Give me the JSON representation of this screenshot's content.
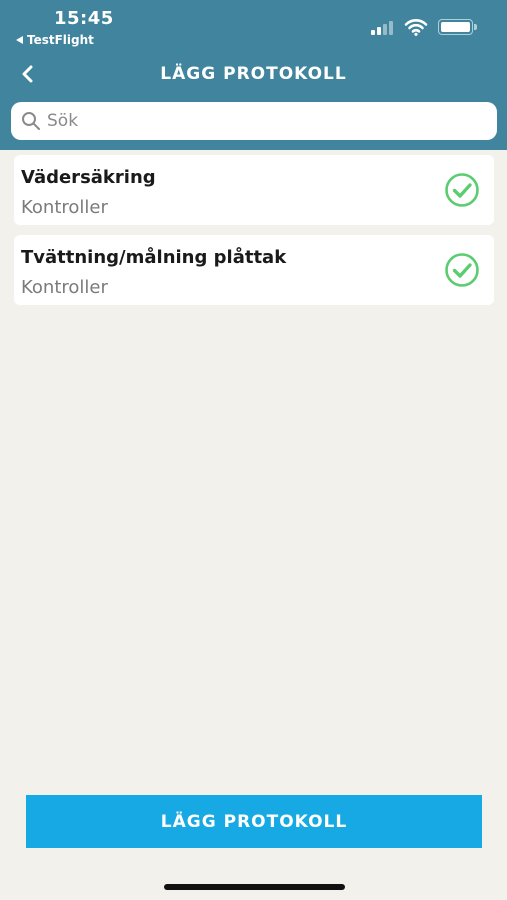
{
  "status_bar": {
    "time": "15:45",
    "back_app": "TestFlight",
    "icons": [
      "cellular-signal-icon",
      "wifi-icon",
      "battery-icon"
    ]
  },
  "nav": {
    "title": "LÄGG PROTOKOLL",
    "back_icon": "chevron-left-icon"
  },
  "search": {
    "placeholder": "Sök",
    "value": "",
    "icon": "search-icon"
  },
  "items": [
    {
      "title": "Vädersäkring",
      "subtitle": "Kontroller",
      "status_icon": "check-circle-icon"
    },
    {
      "title": "Tvättning/målning plåttak",
      "subtitle": "Kontroller",
      "status_icon": "check-circle-icon"
    }
  ],
  "footer": {
    "button_label": "LÄGG PROTOKOLL"
  },
  "colors": {
    "header": "#40849e",
    "background": "#f3f1ec",
    "accent_button": "#16a9e3",
    "check_green": "#5ccc73"
  }
}
